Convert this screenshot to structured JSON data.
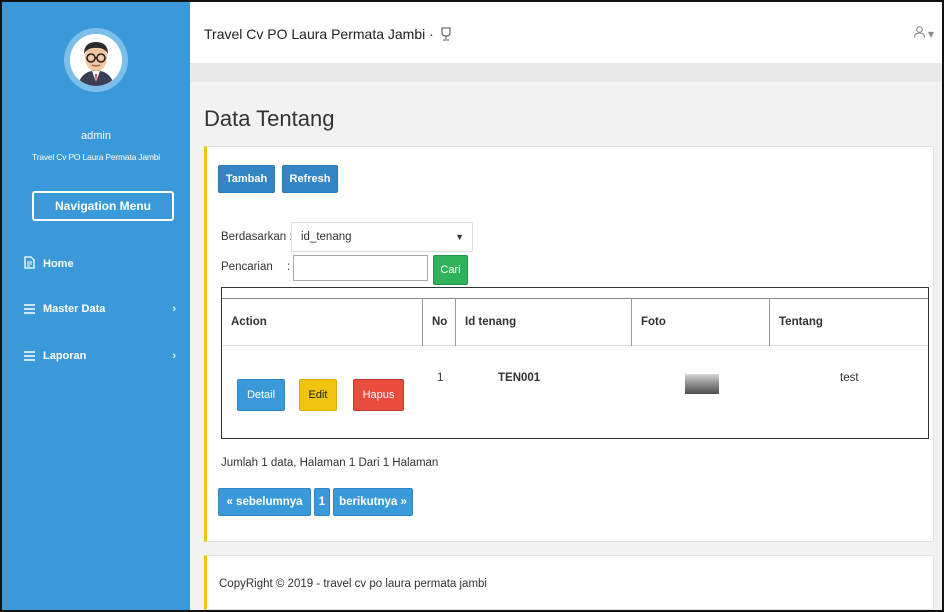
{
  "sidebar": {
    "username": "admin",
    "company": "Travel Cv PO Laura Permata Jambi",
    "nav_button": "Navigation Menu",
    "items": [
      {
        "label": "Home",
        "icon": "file-icon"
      },
      {
        "label": "Master Data",
        "icon": "menu-icon",
        "chevron": "›"
      },
      {
        "label": "Laporan",
        "icon": "menu-icon",
        "chevron": "›"
      }
    ]
  },
  "topbar": {
    "brand": "Travel Cv PO Laura Permata Jambi",
    "brand_icon": "trophy-icon",
    "user_icon": "user-icon",
    "user_caret": "▾"
  },
  "page": {
    "title": "Data Tentang"
  },
  "toolbar": {
    "tambah": "Tambah",
    "refresh": "Refresh"
  },
  "filter": {
    "by_label": "Berdasarkan :",
    "by_value": "id_tenang",
    "search_label": "Pencarian",
    "search_colon": ":",
    "search_value": "",
    "search_button": "Cari"
  },
  "table": {
    "headers": [
      "Action",
      "No",
      "Id tenang",
      "Foto",
      "Tentang"
    ],
    "rows": [
      {
        "no": "1",
        "id": "TEN001",
        "tentang": "test",
        "actions": [
          "Detail",
          "Edit",
          "Hapus"
        ]
      }
    ]
  },
  "summary": "Jumlah 1 data, Halaman 1 Dari 1 Halaman",
  "pagination": {
    "prev": "« sebelumnya",
    "page": "1",
    "next": "berikutnya »"
  },
  "footer": "CopyRight © 2019 - travel cv po laura permata jambi",
  "colors": {
    "sidebar": "#3a9ad9",
    "accent_border": "#f1c40f",
    "primary": "#3385c6",
    "success": "#2fb25a",
    "warning": "#f1c40f",
    "danger": "#e74c3c"
  }
}
